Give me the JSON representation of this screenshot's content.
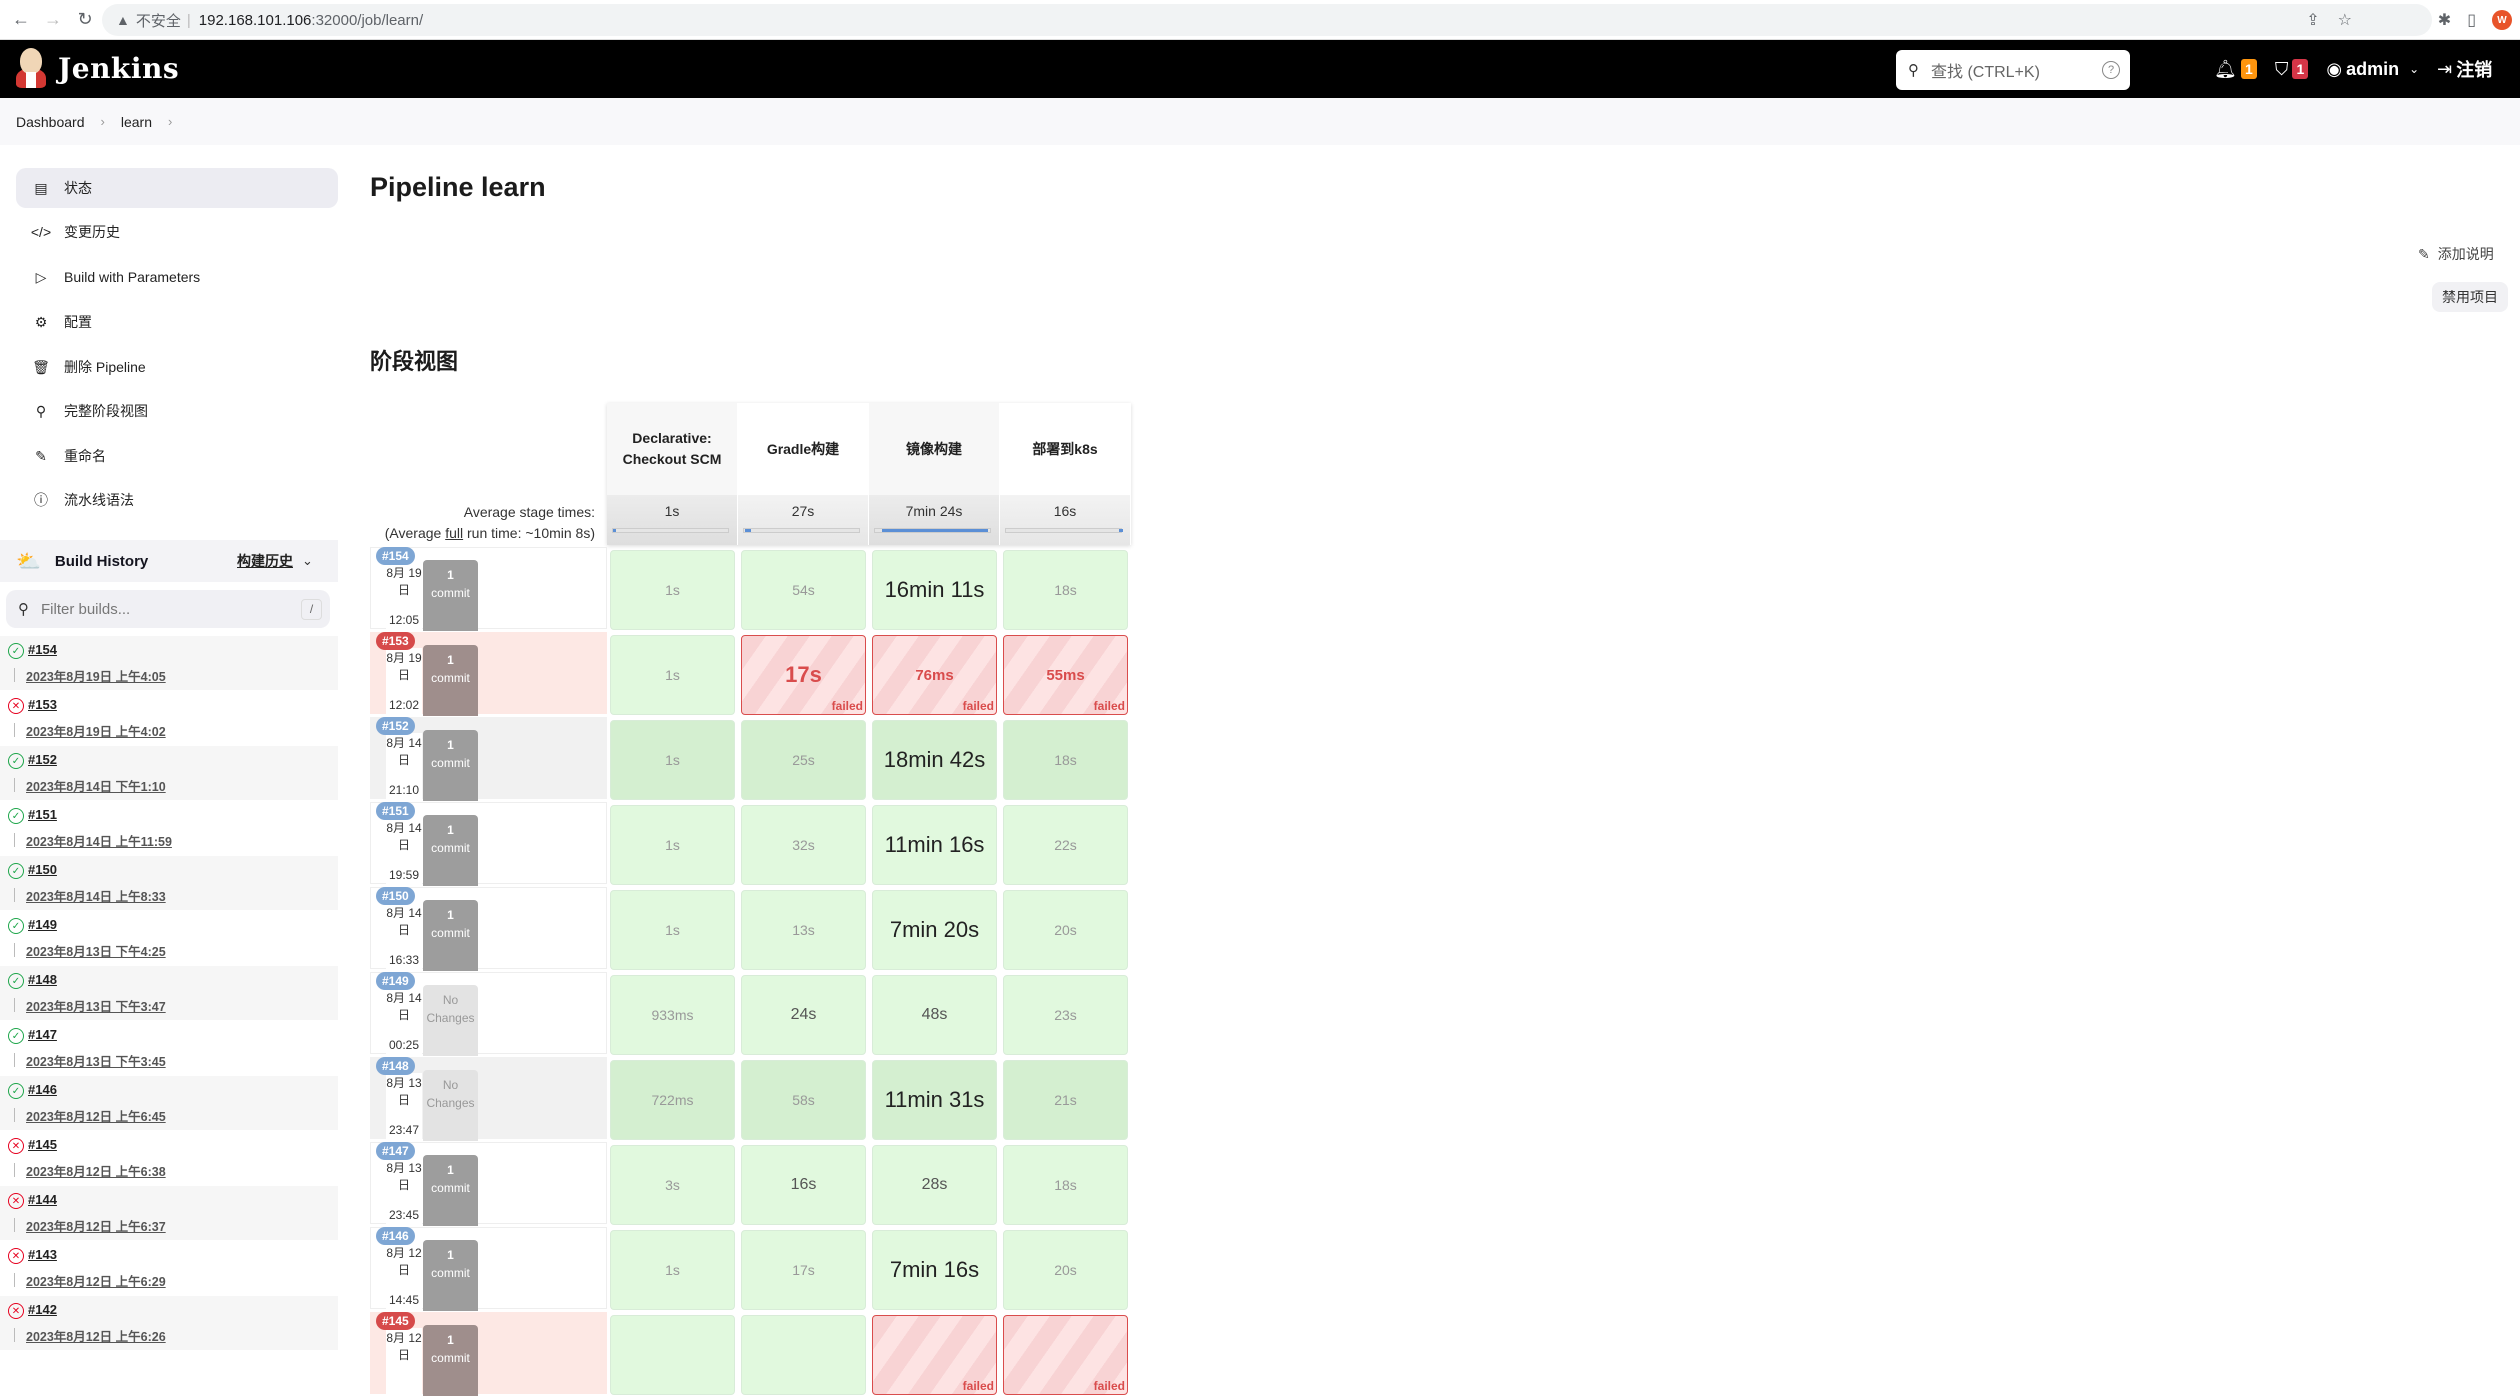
{
  "browser": {
    "insecure_label": "不安全",
    "url_host": "192.168.101.106",
    "url_path": ":32000/job/learn/",
    "profile_initial": "W"
  },
  "header": {
    "logo_text": "Jenkins",
    "search_placeholder": "查找 (CTRL+K)",
    "notifications_count": "1",
    "security_count": "1",
    "user": "admin",
    "logout": "注销",
    "colors": {
      "notif_badge": "#fe950e",
      "security_badge": "#d43547"
    }
  },
  "breadcrumb": [
    "Dashboard",
    "learn"
  ],
  "sidebar": {
    "items": [
      {
        "label": "状态",
        "icon": "document-icon",
        "active": true
      },
      {
        "label": "变更历史",
        "icon": "code-icon"
      },
      {
        "label": "Build with Parameters",
        "icon": "play-icon"
      },
      {
        "label": "配置",
        "icon": "gear-icon"
      },
      {
        "label": "删除 Pipeline",
        "icon": "trash-icon"
      },
      {
        "label": "完整阶段视图",
        "icon": "search-icon"
      },
      {
        "label": "重命名",
        "icon": "pencil-icon"
      },
      {
        "label": "流水线语法",
        "icon": "help-icon"
      }
    ]
  },
  "build_history": {
    "title": "Build History",
    "trend_label": "构建历史",
    "filter_placeholder": "Filter builds...",
    "filter_shortcut": "/",
    "builds": [
      {
        "number": "#154",
        "time": "2023年8月19日 上午4:05",
        "status": "success"
      },
      {
        "number": "#153",
        "time": "2023年8月19日 上午4:02",
        "status": "failed"
      },
      {
        "number": "#152",
        "time": "2023年8月14日 下午1:10",
        "status": "success"
      },
      {
        "number": "#151",
        "time": "2023年8月14日 上午11:59",
        "status": "success"
      },
      {
        "number": "#150",
        "time": "2023年8月14日 上午8:33",
        "status": "success"
      },
      {
        "number": "#149",
        "time": "2023年8月13日 下午4:25",
        "status": "success"
      },
      {
        "number": "#148",
        "time": "2023年8月13日 下午3:47",
        "status": "success"
      },
      {
        "number": "#147",
        "time": "2023年8月13日 下午3:45",
        "status": "success"
      },
      {
        "number": "#146",
        "time": "2023年8月12日 上午6:45",
        "status": "success"
      },
      {
        "number": "#145",
        "time": "2023年8月12日 上午6:38",
        "status": "failed"
      },
      {
        "number": "#144",
        "time": "2023年8月12日 上午6:37",
        "status": "failed"
      },
      {
        "number": "#143",
        "time": "2023年8月12日 上午6:29",
        "status": "failed"
      },
      {
        "number": "#142",
        "time": "2023年8月12日 上午6:26",
        "status": "failed"
      }
    ]
  },
  "main": {
    "title": "Pipeline learn",
    "add_description": "添加说明",
    "disable_project": "禁用项目",
    "stage_view_title": "阶段视图",
    "avg_label_line1": "Average stage times:",
    "avg_label_pre": "(Average ",
    "avg_label_full": "full",
    "avg_label_post": " run time: ~10min 8s)",
    "stages": [
      {
        "name": "Declarative: Checkout SCM",
        "avg": "1s",
        "bar_start": 0.0,
        "bar_end": 0.01
      },
      {
        "name": "Gradle构建",
        "avg": "27s",
        "bar_start": 0.01,
        "bar_end": 0.06
      },
      {
        "name": "镜像构建",
        "avg": "7min 24s",
        "bar_start": 0.06,
        "bar_end": 0.97
      },
      {
        "name": "部署到k8s",
        "avg": "16s",
        "bar_start": 0.97,
        "bar_end": 1.0
      }
    ],
    "runs": [
      {
        "tag": "#154",
        "status": "success",
        "date": "8月 19",
        "day": "日",
        "time": "12:05",
        "changes": "commit",
        "commit_count": "1",
        "commit_label": "commit",
        "cells": [
          {
            "v": "1s"
          },
          {
            "v": "54s"
          },
          {
            "v": "16min 11s"
          },
          {
            "v": "18s"
          }
        ]
      },
      {
        "tag": "#153",
        "status": "failed",
        "date": "8月 19",
        "day": "日",
        "time": "12:02",
        "changes": "commit",
        "commit_count": "1",
        "commit_label": "commit",
        "cells": [
          {
            "v": "1s"
          },
          {
            "v": "17s",
            "failed": true
          },
          {
            "v": "76ms",
            "failed": true
          },
          {
            "v": "55ms",
            "failed": true
          }
        ]
      },
      {
        "tag": "#152",
        "status": "success",
        "date": "8月 14",
        "day": "日",
        "time": "21:10",
        "changes": "commit",
        "commit_count": "1",
        "commit_label": "commit",
        "cells": [
          {
            "v": "1s"
          },
          {
            "v": "25s"
          },
          {
            "v": "18min 42s"
          },
          {
            "v": "18s"
          }
        ]
      },
      {
        "tag": "#151",
        "status": "success",
        "date": "8月 14",
        "day": "日",
        "time": "19:59",
        "changes": "commit",
        "commit_count": "1",
        "commit_label": "commit",
        "cells": [
          {
            "v": "1s"
          },
          {
            "v": "32s"
          },
          {
            "v": "11min 16s"
          },
          {
            "v": "22s"
          }
        ]
      },
      {
        "tag": "#150",
        "status": "success",
        "date": "8月 14",
        "day": "日",
        "time": "16:33",
        "changes": "commit",
        "commit_count": "1",
        "commit_label": "commit",
        "cells": [
          {
            "v": "1s"
          },
          {
            "v": "13s"
          },
          {
            "v": "7min 20s"
          },
          {
            "v": "20s"
          }
        ]
      },
      {
        "tag": "#149",
        "status": "success",
        "date": "8月 14",
        "day": "日",
        "time": "00:25",
        "changes": "none",
        "no_changes_1": "No",
        "no_changes_2": "Changes",
        "cells": [
          {
            "v": "933ms"
          },
          {
            "v": "24s"
          },
          {
            "v": "48s"
          },
          {
            "v": "23s"
          }
        ]
      },
      {
        "tag": "#148",
        "status": "success",
        "date": "8月 13",
        "day": "日",
        "time": "23:47",
        "changes": "none",
        "no_changes_1": "No",
        "no_changes_2": "Changes",
        "cells": [
          {
            "v": "722ms"
          },
          {
            "v": "58s"
          },
          {
            "v": "11min 31s"
          },
          {
            "v": "21s"
          }
        ]
      },
      {
        "tag": "#147",
        "status": "success",
        "date": "8月 13",
        "day": "日",
        "time": "23:45",
        "changes": "commit",
        "commit_count": "1",
        "commit_label": "commit",
        "cells": [
          {
            "v": "3s"
          },
          {
            "v": "16s"
          },
          {
            "v": "28s"
          },
          {
            "v": "18s"
          }
        ]
      },
      {
        "tag": "#146",
        "status": "success",
        "date": "8月 12",
        "day": "日",
        "time": "14:45",
        "changes": "commit",
        "commit_count": "1",
        "commit_label": "commit",
        "cells": [
          {
            "v": "1s"
          },
          {
            "v": "17s"
          },
          {
            "v": "7min 16s"
          },
          {
            "v": "20s"
          }
        ]
      },
      {
        "tag": "#145",
        "status": "failed",
        "date": "8月 12",
        "day": "日",
        "time": "",
        "changes": "commit",
        "commit_count": "1",
        "commit_label": "commit",
        "cells": [
          {
            "v": ""
          },
          {
            "v": ""
          },
          {
            "v": "",
            "failed": true
          },
          {
            "v": "",
            "failed": true
          }
        ]
      }
    ],
    "failed_label": "failed"
  }
}
